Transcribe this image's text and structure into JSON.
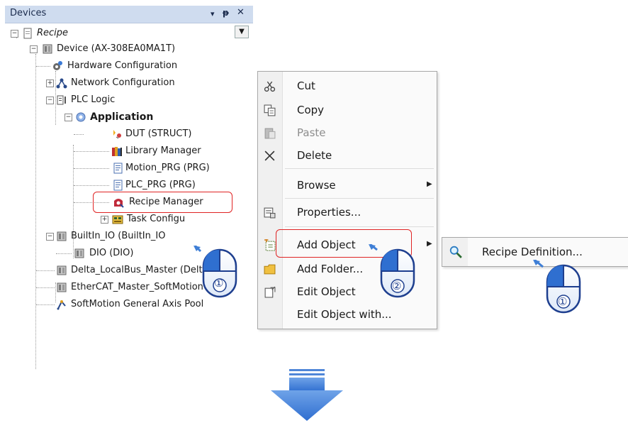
{
  "panel": {
    "title": "Devices",
    "pin_glyph": "▾",
    "dock_glyph": "ꟸ",
    "close_glyph": "✕",
    "dropdown_glyph": "▼"
  },
  "tree": {
    "items": [
      {
        "label": "Recipe"
      },
      {
        "label": "Device (AX-308EA0MA1T)"
      },
      {
        "label": "Hardware Configuration"
      },
      {
        "label": "Network Configuration"
      },
      {
        "label": "PLC Logic"
      },
      {
        "label": "Application"
      },
      {
        "label": "DUT (STRUCT)"
      },
      {
        "label": "Library Manager"
      },
      {
        "label": "Motion_PRG (PRG)"
      },
      {
        "label": "PLC_PRG (PRG)"
      },
      {
        "label": "Recipe Manager"
      },
      {
        "label": "Task Configu"
      },
      {
        "label": "BuiltIn_IO (BuiltIn_IO"
      },
      {
        "label": "DIO (DIO)"
      },
      {
        "label": "Delta_LocalBus_Master (Delta"
      },
      {
        "label": "EtherCAT_Master_SoftMotion"
      },
      {
        "label": "SoftMotion General Axis Pool"
      }
    ]
  },
  "context_menu": {
    "items": [
      {
        "label": "Cut",
        "icon": "scissors-icon"
      },
      {
        "label": "Copy",
        "icon": "copy-icon"
      },
      {
        "label": "Paste",
        "icon": "paste-icon"
      },
      {
        "label": "Delete",
        "icon": "delete-x-icon"
      },
      {
        "label": "Browse",
        "icon": ""
      },
      {
        "label": "Properties...",
        "icon": "properties-icon"
      },
      {
        "label": "Add Object",
        "icon": "add-object-icon"
      },
      {
        "label": "Add Folder...",
        "icon": "folder-icon"
      },
      {
        "label": "Edit Object",
        "icon": "edit-object-icon"
      },
      {
        "label": "Edit Object with...",
        "icon": ""
      }
    ]
  },
  "submenu": {
    "items": [
      {
        "label": "Recipe Definition...",
        "icon": "magnifier-icon"
      }
    ]
  },
  "callouts": {
    "mouse_tree": "①",
    "mouse_menu": "②",
    "mouse_submenu": "①"
  },
  "colors": {
    "highlight_red": "#e02424",
    "arrow_blue": "#3f7fd6",
    "titlebar": "#cfdcef"
  }
}
